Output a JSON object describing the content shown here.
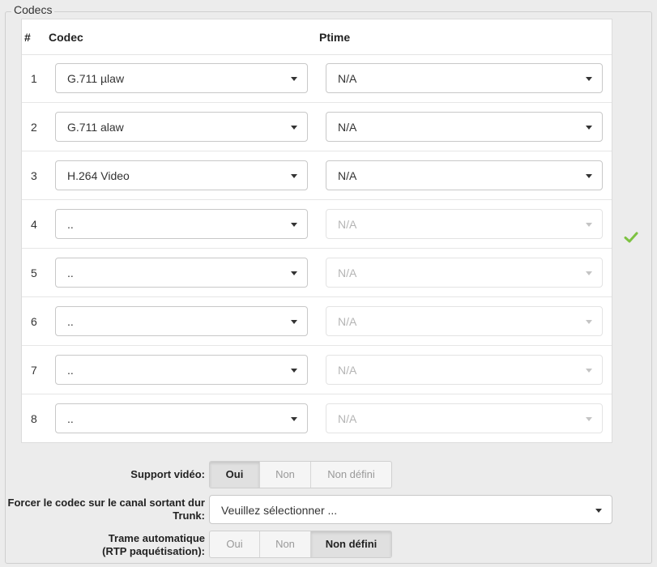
{
  "fieldset": {
    "legend": "Codecs"
  },
  "table": {
    "headers": {
      "index": "#",
      "codec": "Codec",
      "ptime": "Ptime"
    },
    "rows": [
      {
        "index": "1",
        "codec": "G.711 µlaw",
        "ptime": "N/A",
        "ptime_enabled": true
      },
      {
        "index": "2",
        "codec": "G.711 alaw",
        "ptime": "N/A",
        "ptime_enabled": true
      },
      {
        "index": "3",
        "codec": "H.264 Video",
        "ptime": "N/A",
        "ptime_enabled": true
      },
      {
        "index": "4",
        "codec": "..",
        "ptime": "N/A",
        "ptime_enabled": false
      },
      {
        "index": "5",
        "codec": "..",
        "ptime": "N/A",
        "ptime_enabled": false
      },
      {
        "index": "6",
        "codec": "..",
        "ptime": "N/A",
        "ptime_enabled": false
      },
      {
        "index": "7",
        "codec": "..",
        "ptime": "N/A",
        "ptime_enabled": false
      },
      {
        "index": "8",
        "codec": "..",
        "ptime": "N/A",
        "ptime_enabled": false
      }
    ]
  },
  "status": {
    "icon": "checkmark-icon",
    "color": "#7dc242"
  },
  "support_video": {
    "label": "Support vidéo:",
    "options": [
      "Oui",
      "Non",
      "Non défini"
    ],
    "selected": "Oui"
  },
  "force_codec": {
    "label_line1": "Forcer le codec sur le canal sortant dur",
    "label_line2": "Trunk:",
    "value": "Veuillez sélectionner ..."
  },
  "trame_auto": {
    "label_line1": "Trame automatique",
    "label_line2": "(RTP paquétisation):",
    "options": [
      "Oui",
      "Non",
      "Non défini"
    ],
    "selected": "Non défini"
  }
}
